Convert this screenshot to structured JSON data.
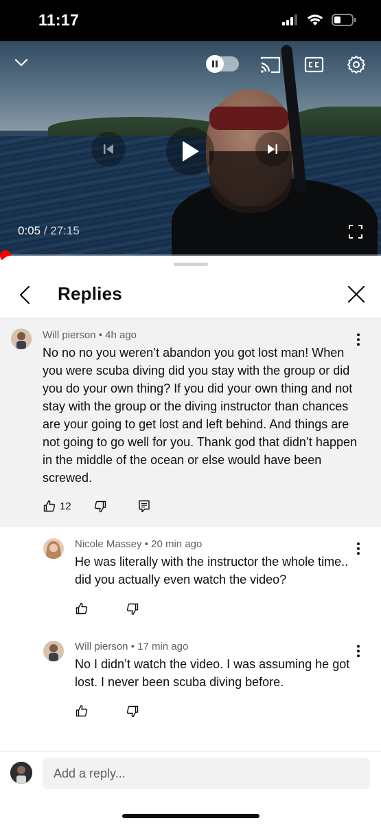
{
  "status_bar": {
    "time": "11:17",
    "icons": [
      "cellular-signal-icon",
      "wifi-icon",
      "battery-icon"
    ]
  },
  "player": {
    "current_time": "0:05",
    "separator": " / ",
    "duration": "27:15",
    "progress_fraction": 0.003,
    "accent_color": "#ff0000",
    "controls": [
      "collapse-icon",
      "autoplay-toggle",
      "cast-icon",
      "captions-icon",
      "settings-icon",
      "previous-icon",
      "play-icon",
      "next-icon",
      "fullscreen-icon"
    ]
  },
  "sheet": {
    "title": "Replies"
  },
  "comments": [
    {
      "author": "Will pierson",
      "time": "4h ago",
      "text": "No no no you weren’t abandon you got lost man! When you were scuba diving did you stay with the group or did you do your own thing? If you did your own thing and not stay with the group or the diving instructor than chances are your going to get lost and left behind. And things are not going to go well for you. Thank god that didn’t happen in the middle of the ocean or else would have been screwed.",
      "likes": "12"
    },
    {
      "author": "Nicole Massey",
      "time": "20 min ago",
      "text": "He was literally with the instructor the whole time.. did you actually even watch the video?"
    },
    {
      "author": "Will pierson",
      "time": "17 min ago",
      "text": "No I didn’t watch the video. I was assuming he got lost. I never been scuba diving before."
    }
  ],
  "reply_box": {
    "placeholder": "Add a reply..."
  }
}
